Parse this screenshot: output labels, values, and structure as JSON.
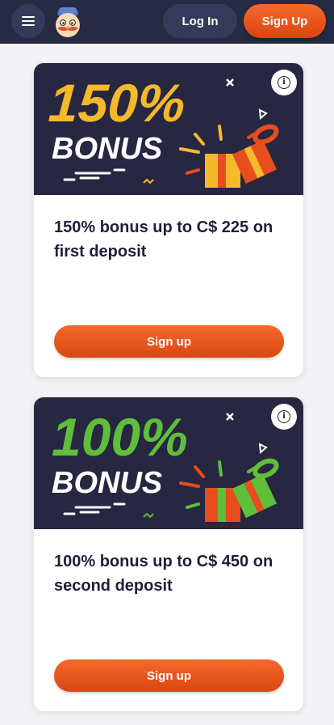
{
  "header": {
    "login_label": "Log In",
    "signup_label": "Sign Up",
    "menu_icon": "hamburger-menu-icon",
    "logo_icon": "mascot-logo-icon"
  },
  "cards": [
    {
      "banner_percent": "150%",
      "banner_word": "BONUS",
      "banner_color": "#f6b92c",
      "title": "150% bonus up to C$ 225 on first deposit",
      "button_label": "Sign up",
      "info_label": "i"
    },
    {
      "banner_percent": "100%",
      "banner_word": "BONUS",
      "banner_color": "#5fbf3a",
      "title": "100% bonus up to C$ 450 on second deposit",
      "button_label": "Sign up",
      "info_label": "i"
    }
  ],
  "colors": {
    "header_bg": "#262a43",
    "accent_orange": "#ec5a1f",
    "page_bg": "#f3f3f6",
    "banner_bg": "#272742"
  }
}
